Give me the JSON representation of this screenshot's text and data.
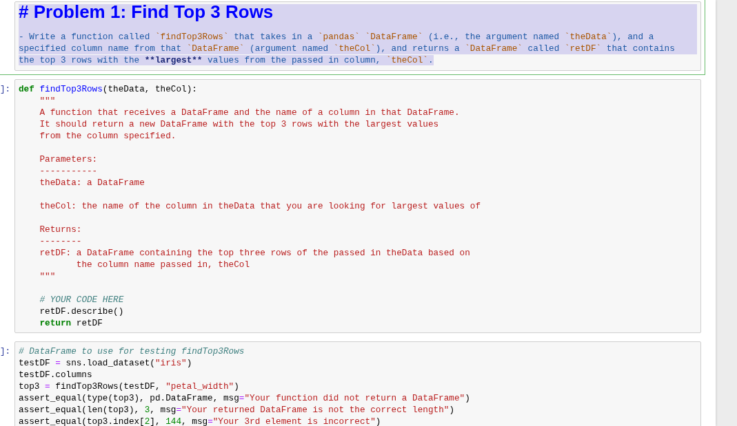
{
  "cells": [
    {
      "kind": "markdown",
      "selected": true,
      "text_selected": true,
      "blocks": [
        [
          [
            {
              "kind": "header",
              "text": "# Problem 1: Find Top 3 Rows"
            }
          ]
        ],
        [
          [
            {
              "kind": "text",
              "text": "- Write a function called "
            },
            {
              "kind": "code",
              "text": "`findTop3Rows`"
            },
            {
              "kind": "text",
              "text": " that takes in a "
            },
            {
              "kind": "code",
              "text": "`pandas` `DataFrame`"
            },
            {
              "kind": "text",
              "text": " (i.e., the argument named "
            },
            {
              "kind": "code",
              "text": "`theData`"
            },
            {
              "kind": "text",
              "text": "), and a"
            }
          ],
          [
            {
              "kind": "text",
              "text": "specified column name from that "
            },
            {
              "kind": "code",
              "text": "`DataFrame`"
            },
            {
              "kind": "text",
              "text": " (argument named "
            },
            {
              "kind": "code",
              "text": "`theCol`"
            },
            {
              "kind": "text",
              "text": "), and returns a "
            },
            {
              "kind": "code",
              "text": "`DataFrame`"
            },
            {
              "kind": "text",
              "text": " called "
            },
            {
              "kind": "code",
              "text": "`retDF`"
            },
            {
              "kind": "text",
              "text": " that contains"
            }
          ],
          [
            {
              "kind": "text",
              "text": "the top 3 rows with the "
            },
            {
              "kind": "strong",
              "text": "**largest**"
            },
            {
              "kind": "text",
              "text": " values from the passed in column, "
            },
            {
              "kind": "code",
              "text": "`theCol`"
            },
            {
              "kind": "text",
              "text": "."
            }
          ]
        ]
      ]
    },
    {
      "kind": "code",
      "selected": false,
      "text_selected": false,
      "prompt": "]:",
      "blocks": [
        [
          [
            {
              "kind": "keyword",
              "text": "def "
            },
            {
              "kind": "def",
              "text": "findTop3Rows"
            },
            {
              "kind": "plain",
              "text": "(theData, theCol):"
            }
          ],
          [
            {
              "kind": "string",
              "text": "    \"\"\""
            }
          ],
          [
            {
              "kind": "string",
              "text": "    A function that receives a DataFrame and the name of a column in that DataFrame."
            }
          ],
          [
            {
              "kind": "string",
              "text": "    It should return a new DataFrame with the top 3 rows with the largest values"
            }
          ],
          [
            {
              "kind": "string",
              "text": "    from the column specified."
            }
          ]
        ],
        [
          [
            {
              "kind": "string",
              "text": "    Parameters:"
            }
          ],
          [
            {
              "kind": "string",
              "text": "    -----------"
            }
          ],
          [
            {
              "kind": "string",
              "text": "    theData: a DataFrame"
            }
          ]
        ],
        [
          [
            {
              "kind": "string",
              "text": "    theCol: the name of the column in theData that you are looking for largest values of"
            }
          ]
        ],
        [
          [
            {
              "kind": "string",
              "text": "    Returns:"
            }
          ],
          [
            {
              "kind": "string",
              "text": "    --------"
            }
          ],
          [
            {
              "kind": "string",
              "text": "    retDF: a DataFrame containing the top three rows of the passed in theData based on"
            }
          ],
          [
            {
              "kind": "string",
              "text": "           the column name passed in, theCol"
            }
          ],
          [
            {
              "kind": "string",
              "text": "    \"\"\""
            }
          ]
        ],
        [
          [
            {
              "kind": "comment",
              "text": "    # YOUR CODE HERE"
            }
          ],
          [
            {
              "kind": "plain",
              "text": "    retDF.describe()"
            }
          ],
          [
            {
              "kind": "keyword",
              "text": "    return"
            },
            {
              "kind": "plain",
              "text": " retDF"
            }
          ]
        ]
      ]
    },
    {
      "kind": "code",
      "selected": false,
      "text_selected": false,
      "prompt": "]:",
      "blocks": [
        [
          [
            {
              "kind": "comment",
              "text": "# DataFrame to use for testing findTop3Rows"
            }
          ],
          [
            {
              "kind": "plain",
              "text": "testDF "
            },
            {
              "kind": "operator",
              "text": "="
            },
            {
              "kind": "plain",
              "text": " sns.load_dataset("
            },
            {
              "kind": "string",
              "text": "\"iris\""
            },
            {
              "kind": "plain",
              "text": ")"
            }
          ],
          [
            {
              "kind": "plain",
              "text": "testDF.columns"
            }
          ],
          [
            {
              "kind": "plain",
              "text": "top3 "
            },
            {
              "kind": "operator",
              "text": "="
            },
            {
              "kind": "plain",
              "text": " findTop3Rows(testDF, "
            },
            {
              "kind": "string",
              "text": "\"petal_width\""
            },
            {
              "kind": "plain",
              "text": ")"
            }
          ],
          [
            {
              "kind": "plain",
              "text": "assert_equal(type(top3), pd.DataFrame, msg"
            },
            {
              "kind": "operator",
              "text": "="
            },
            {
              "kind": "string",
              "text": "\"Your function did not return a DataFrame\""
            },
            {
              "kind": "plain",
              "text": ")"
            }
          ],
          [
            {
              "kind": "plain",
              "text": "assert_equal(len(top3), "
            },
            {
              "kind": "number",
              "text": "3"
            },
            {
              "kind": "plain",
              "text": ", msg"
            },
            {
              "kind": "operator",
              "text": "="
            },
            {
              "kind": "string",
              "text": "\"Your returned DataFrame is not the correct length\""
            },
            {
              "kind": "plain",
              "text": ")"
            }
          ],
          [
            {
              "kind": "plain",
              "text": "assert_equal(top3.index["
            },
            {
              "kind": "number",
              "text": "2"
            },
            {
              "kind": "plain",
              "text": "], "
            },
            {
              "kind": "number",
              "text": "144"
            },
            {
              "kind": "plain",
              "text": ", msg"
            },
            {
              "kind": "operator",
              "text": "="
            },
            {
              "kind": "string",
              "text": "\"Your 3rd element is incorrect\""
            },
            {
              "kind": "plain",
              "text": ")"
            }
          ]
        ]
      ]
    }
  ]
}
